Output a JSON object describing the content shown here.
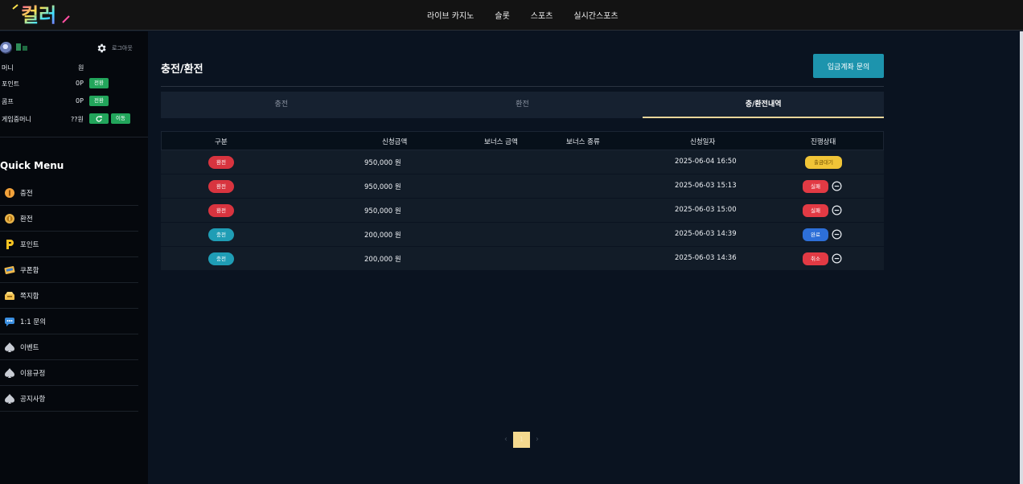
{
  "header": {
    "logo_text": "컬러",
    "nav": [
      "라이브 카지노",
      "슬롯",
      "스포츠",
      "실시간스포츠"
    ]
  },
  "sidebar": {
    "user_icon": "avatar-icon",
    "logout_label": "로그아웃",
    "wallet": [
      {
        "label": "머니",
        "value": "원",
        "button": ""
      },
      {
        "label": "포인트",
        "value": "0P",
        "button": "전환"
      },
      {
        "label": "콤프",
        "value": "0P",
        "button": "전환"
      },
      {
        "label": "게임중머니",
        "value": "??원",
        "button": "이동"
      }
    ],
    "quick_menu_title": "Quick Menu",
    "menu": [
      {
        "label": "충전",
        "icon": "coin-icon"
      },
      {
        "label": "환전",
        "icon": "coin-exchange-icon"
      },
      {
        "label": "포인트",
        "icon": "point-p-icon"
      },
      {
        "label": "쿠폰함",
        "icon": "coupon-icon"
      },
      {
        "label": "쪽지함",
        "icon": "message-box-icon"
      },
      {
        "label": "1:1 문의",
        "icon": "chat-icon"
      },
      {
        "label": "이벤트",
        "icon": "spade-icon"
      },
      {
        "label": "이용규정",
        "icon": "spade-icon"
      },
      {
        "label": "공지사항",
        "icon": "spade-icon"
      }
    ]
  },
  "main": {
    "title": "충전/환전",
    "inquiry_button": "입금계좌 문의",
    "tabs": [
      "충전",
      "환전",
      "충/환전내역"
    ],
    "active_tab": 2,
    "columns": [
      "구분",
      "신청금액",
      "보너스 금액",
      "보너스 종류",
      "신청일자",
      "진행상태"
    ],
    "rows": [
      {
        "type": "환전",
        "amount": "950,000 원",
        "bonus_amount": "",
        "bonus_type": "",
        "date": "2025-06-04 16:50",
        "status": "출금대기"
      },
      {
        "type": "환전",
        "amount": "950,000 원",
        "bonus_amount": "",
        "bonus_type": "",
        "date": "2025-06-03 15:13",
        "status": "실패"
      },
      {
        "type": "환전",
        "amount": "950,000 원",
        "bonus_amount": "",
        "bonus_type": "",
        "date": "2025-06-03 15:00",
        "status": "실패"
      },
      {
        "type": "충전",
        "amount": "200,000 원",
        "bonus_amount": "",
        "bonus_type": "",
        "date": "2025-06-03 14:39",
        "status": "완료"
      },
      {
        "type": "충전",
        "amount": "200,000 원",
        "bonus_amount": "",
        "bonus_type": "",
        "date": "2025-06-03 14:36",
        "status": "취소"
      }
    ],
    "pagination": {
      "prev": "‹",
      "current": "1",
      "next": "›"
    }
  },
  "colors": {
    "accent_teal": "#1d94ad",
    "withdraw_red": "#d8343f",
    "deposit_teal": "#1f9db5",
    "status_wait": "#f0c437",
    "status_fail": "#e23a44",
    "status_done": "#2d6fd8",
    "green_button": "#22a55b",
    "tab_underline": "#e8d59a"
  }
}
